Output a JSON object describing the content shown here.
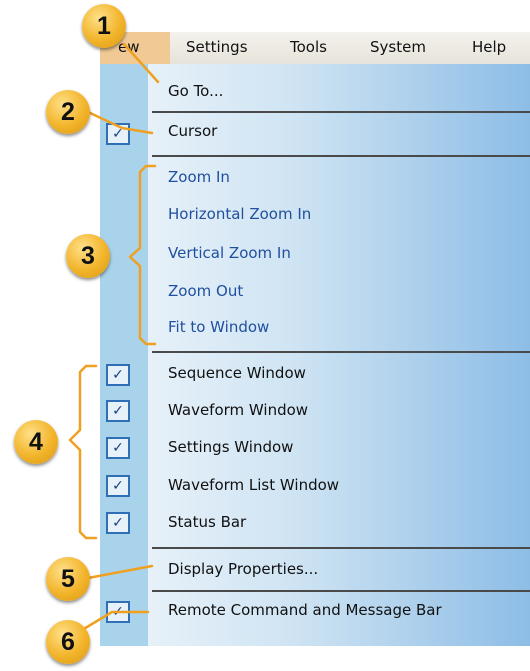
{
  "menubar": {
    "items": [
      "ew",
      "Settings",
      "Tools",
      "System",
      "Help"
    ]
  },
  "menu": {
    "goto": "Go To...",
    "cursor": "Cursor",
    "zoom": [
      "Zoom In",
      "Horizontal Zoom In",
      "Vertical Zoom In",
      "Zoom Out",
      "Fit to Window"
    ],
    "windows": [
      "Sequence Window",
      "Waveform Window",
      "Settings Window",
      "Waveform List Window",
      "Status Bar"
    ],
    "display_properties": "Display Properties...",
    "remote_bar": "Remote Command and Message Bar"
  },
  "check_mark": "✓",
  "callouts": [
    "1",
    "2",
    "3",
    "4",
    "5",
    "6"
  ],
  "colors": {
    "callout": "#f2b42a",
    "callout_line": "#f0a020",
    "zoom_text": "#1f4f9e",
    "active_menu": "#f0c994",
    "check_border": "#2f6fb5"
  }
}
